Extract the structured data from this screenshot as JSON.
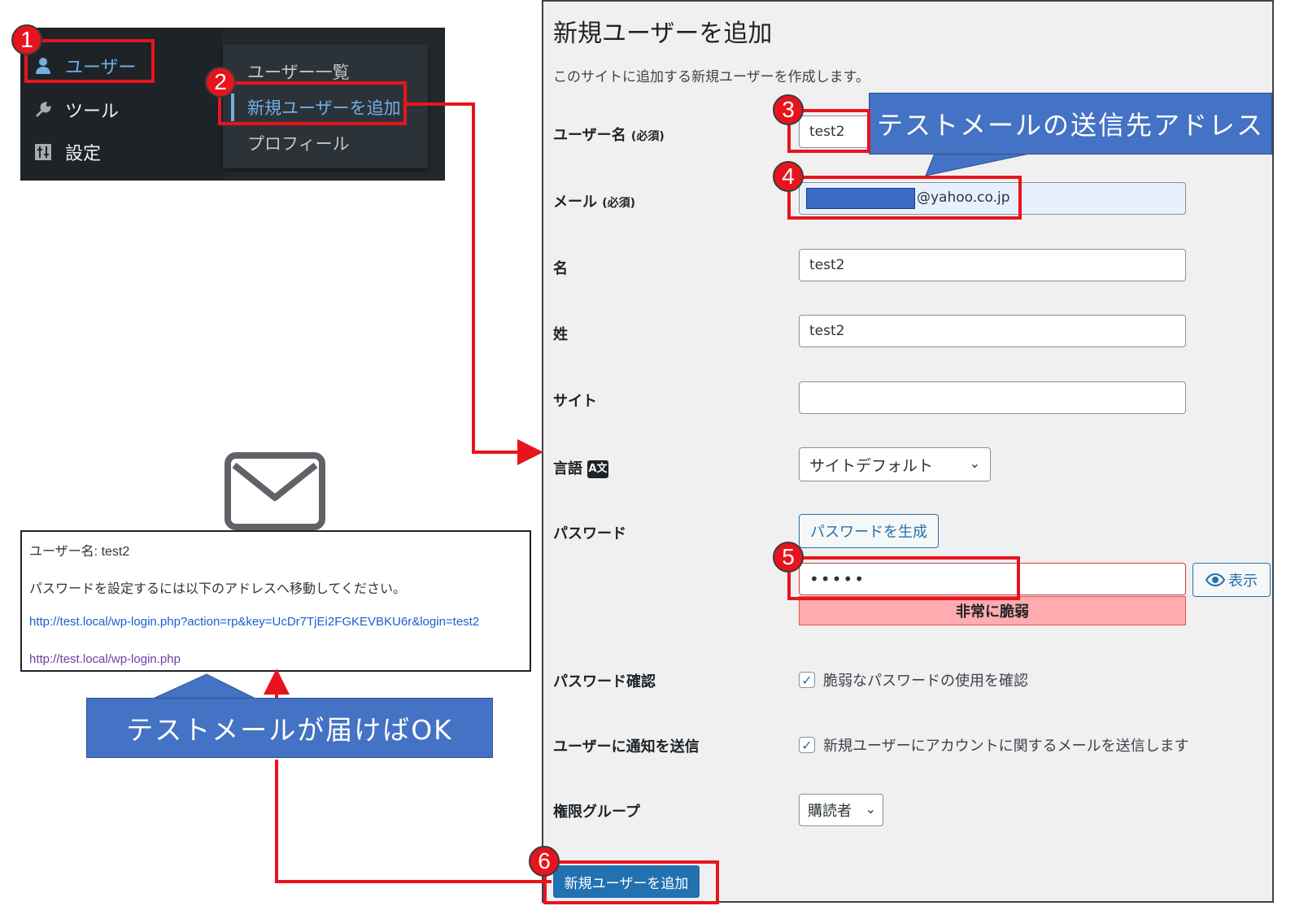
{
  "admin_menu": {
    "items": [
      {
        "label": "ユーザー",
        "icon": "user-icon"
      },
      {
        "label": "ツール",
        "icon": "wrench-icon"
      },
      {
        "label": "設定",
        "icon": "sliders-icon"
      }
    ],
    "submenu": [
      "ユーザー一覧",
      "新規ユーザーを追加",
      "プロフィール"
    ]
  },
  "form": {
    "title": "新規ユーザーを追加",
    "description": "このサイトに追加する新規ユーザーを作成します。",
    "required_mark": "(必須)",
    "fields": {
      "username": {
        "label": "ユーザー名",
        "value": "test2"
      },
      "email": {
        "label": "メール",
        "value_domain": "@yahoo.co.jp"
      },
      "first_name": {
        "label": "名",
        "value": "test2"
      },
      "last_name": {
        "label": "姓",
        "value": "test2"
      },
      "website": {
        "label": "サイト",
        "value": ""
      },
      "language": {
        "label": "言語",
        "value": "サイトデフォルト",
        "icon": "translation-icon"
      },
      "password": {
        "label": "パスワード",
        "generate_button": "パスワードを生成",
        "value": "•••••",
        "strength": "非常に脆弱",
        "show_button": "表示",
        "show_icon": "eye-icon"
      },
      "password_confirm": {
        "label": "パスワード確認",
        "checkbox_label": "脆弱なパスワードの使用を確認",
        "checked": true
      },
      "send_notification": {
        "label": "ユーザーに通知を送信",
        "checkbox_label": "新規ユーザーにアカウントに関するメールを送信します",
        "checked": true
      },
      "role": {
        "label": "権限グループ",
        "value": "購読者"
      }
    },
    "submit_label": "新規ユーザーを追加"
  },
  "callouts": {
    "email_target": "テストメールの送信先アドレス",
    "mail_ok": "テストメールが届けばOK"
  },
  "email_message": {
    "username_line": "ユーザー名: test2",
    "instruction": "パスワードを設定するには以下のアドレスへ移動してください。",
    "reset_link": "http://test.local/wp-login.php?action=rp&key=UcDr7TjEi2FGKEVBKU6r&login=test2",
    "login_link": "http://test.local/wp-login.php"
  },
  "step_badges": [
    "1",
    "2",
    "3",
    "4",
    "5",
    "6"
  ],
  "colors": {
    "highlight": "#e8141d",
    "callout": "#4472c4",
    "wp_blue": "#2271b1",
    "menu_bg": "#1d2327"
  }
}
